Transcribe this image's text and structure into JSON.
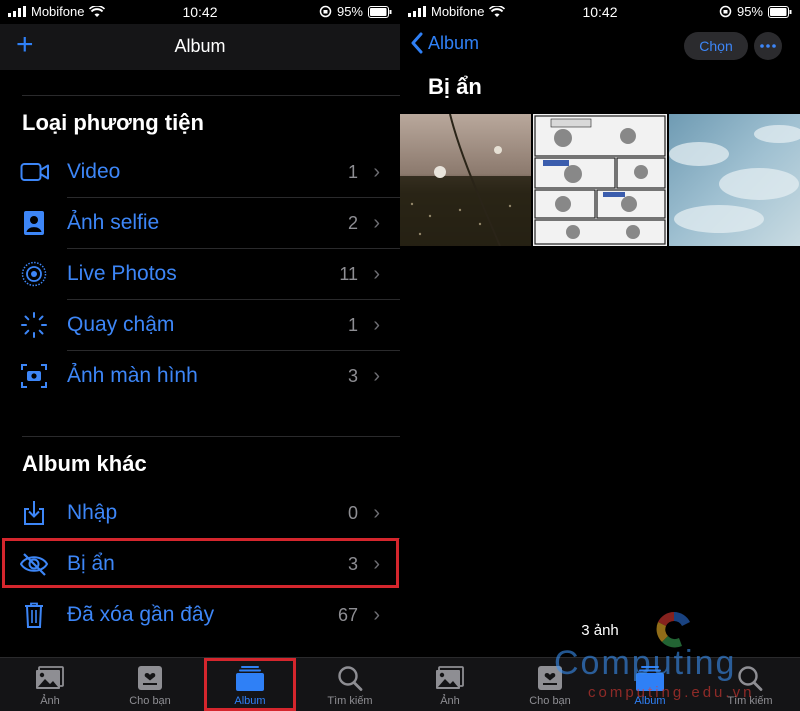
{
  "status": {
    "carrier": "Mobifone",
    "time": "10:42",
    "battery": "95%"
  },
  "left": {
    "title": "Album",
    "media_section": "Loại phương tiện",
    "media_items": [
      {
        "icon": "video-icon",
        "label": "Video",
        "count": "1"
      },
      {
        "icon": "selfie-icon",
        "label": "Ảnh selfie",
        "count": "2"
      },
      {
        "icon": "live-photos-icon",
        "label": "Live Photos",
        "count": "11"
      },
      {
        "icon": "slow-motion-icon",
        "label": "Quay chậm",
        "count": "1"
      },
      {
        "icon": "screenshot-icon",
        "label": "Ảnh màn hình",
        "count": "3"
      }
    ],
    "other_section": "Album khác",
    "other_items": [
      {
        "icon": "import-icon",
        "label": "Nhập",
        "count": "0"
      },
      {
        "icon": "hidden-icon",
        "label": "Bị ẩn",
        "count": "3"
      },
      {
        "icon": "trash-icon",
        "label": "Đã xóa gần đây",
        "count": "67"
      }
    ]
  },
  "tabs": [
    {
      "icon": "photos-tab-icon",
      "label": "Ảnh"
    },
    {
      "icon": "for-you-tab-icon",
      "label": "Cho bạn"
    },
    {
      "icon": "album-tab-icon",
      "label": "Album"
    },
    {
      "icon": "search-tab-icon",
      "label": "Tìm kiếm"
    }
  ],
  "active_tab": "Album",
  "right": {
    "back_label": "Album",
    "select_label": "Chọn",
    "title": "Bị ẩn",
    "photo_count": "3 ảnh"
  },
  "watermark": {
    "word": "Computing",
    "url": "computing.edu.vn"
  },
  "colors": {
    "accent": "#2f80f6",
    "highlight": "#d5262d",
    "background": "#000000"
  }
}
